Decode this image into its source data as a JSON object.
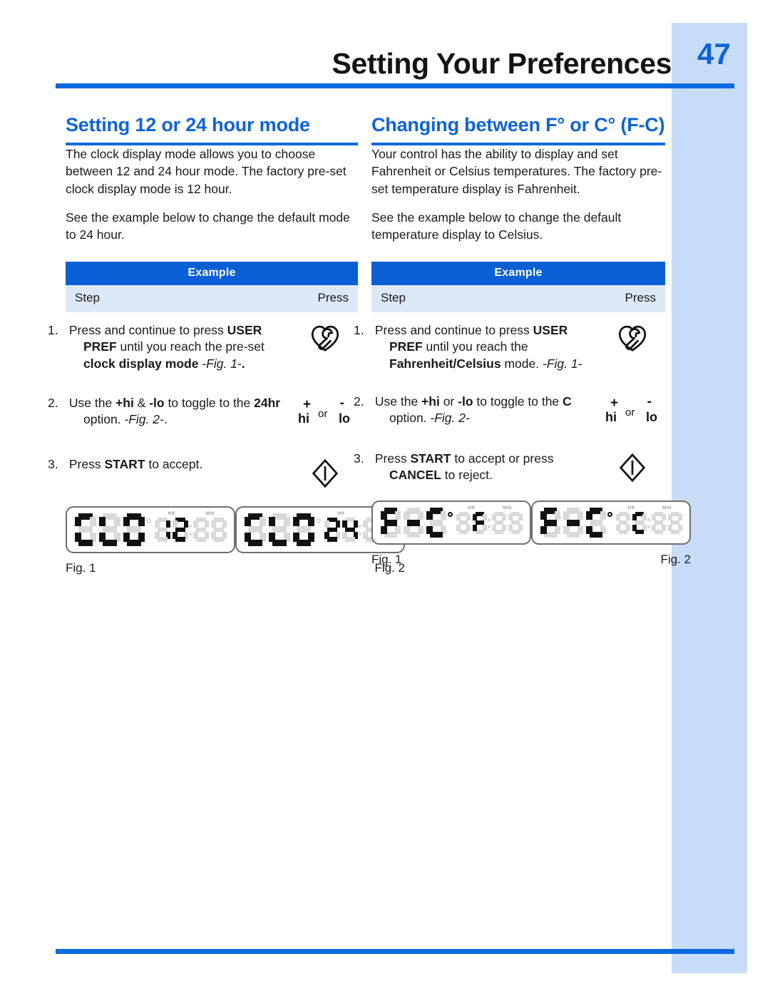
{
  "header": {
    "title": "Setting Your Preferences",
    "page_number": "47"
  },
  "columns": {
    "left": {
      "heading": "Setting 12 or 24 hour mode",
      "paragraphs": [
        "The clock display mode allows you to choose between 12 and 24 hour mode. The factory pre-set clock display mode is 12 hour.",
        "See the example below to change the default mode to 24 hour."
      ],
      "example": {
        "title": "Example",
        "col_step": "Step",
        "col_press": "Press",
        "steps": [
          {
            "number": "1.",
            "text_html": "Press and continue to press <b>USER PREF</b> until you reach the pre-set <b>clock display mode</b> <i>-Fig. 1-</i><b>.</b>",
            "icon": "user-pref-wrench-icon"
          },
          {
            "number": "2.",
            "text_html": "Use the <b>+hi</b> &amp; <b>-lo</b> to toggle to the <b>24hr</b> option. <i>-Fig. 2-</i>.",
            "icon": "plus-hi-or-minus-lo-icon"
          },
          {
            "number": "3.",
            "text_html": "Press <b>START</b> to accept.",
            "icon": "start-diamond-icon"
          }
        ]
      },
      "figures": [
        {
          "caption": "Fig. 1",
          "lcd_word": "CLO",
          "lcd_value": "12",
          "degree_on": false,
          "hr_label": "HR",
          "min_label": "MIN"
        },
        {
          "caption": "Fig. 2",
          "lcd_word": "CLO",
          "lcd_value": "24",
          "degree_on": false,
          "hr_label": "HR",
          "min_label": "MIN"
        }
      ]
    },
    "right": {
      "heading": "Changing between F° or C° (F-C)",
      "paragraphs": [
        "Your control has the ability to display and set Fahrenheit or Celsius temperatures. The factory pre-set temperature display is Fahrenheit.",
        "See the example below to change the default temperature display to Celsius."
      ],
      "example": {
        "title": "Example",
        "col_step": "Step",
        "col_press": "Press",
        "steps": [
          {
            "number": "1.",
            "text_html": "Press and continue to press <b>USER PREF</b> until you reach the <b>Fahrenheit/Celsius</b> mode. <i>-Fig. 1-</i>",
            "icon": "user-pref-wrench-icon"
          },
          {
            "number": "2.",
            "text_html": "Use the <b>+hi</b> or <b>-lo</b> to toggle to the <b>C</b> option. <i>-Fig. 2-</i>",
            "icon": "plus-hi-or-minus-lo-icon"
          },
          {
            "number": "3.",
            "text_html": "Press <b>START</b> to accept or press <b>CANCEL</b> to reject.",
            "icon": "start-diamond-icon"
          }
        ]
      },
      "figures": [
        {
          "caption": "Fig. 1",
          "lcd_word": "F-C",
          "lcd_value": "F",
          "degree_on": true,
          "hr_label": "HR",
          "min_label": "MIN"
        },
        {
          "caption": "Fig. 2",
          "lcd_word": "F-C",
          "lcd_value": "C",
          "degree_on": true,
          "hr_label": "HR",
          "min_label": "MIN"
        }
      ]
    }
  },
  "colors": {
    "accent_blue": "#0b6ae0",
    "heading_blue": "#0f63d6",
    "table_header_blue": "#0b5fd4",
    "table_subrow_blue": "#dde8f7",
    "sidebar_blue": "#c7dcf7",
    "lcd_on": "#111111",
    "lcd_off": "#d9d9d9"
  }
}
